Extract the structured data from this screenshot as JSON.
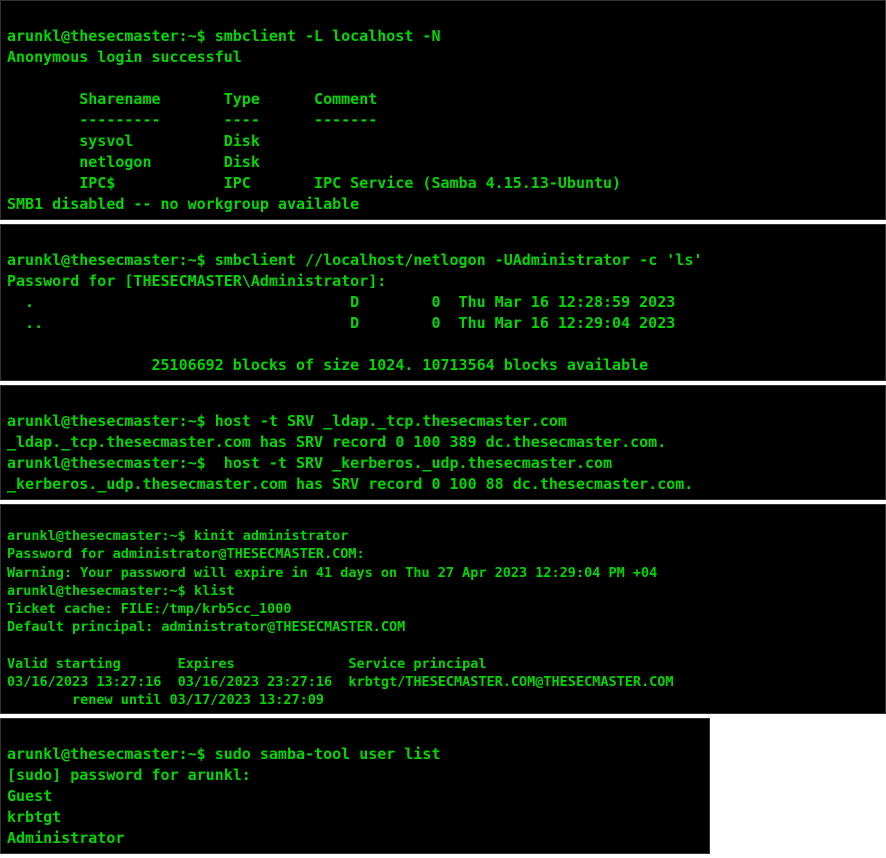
{
  "panels": {
    "p1": {
      "prompt": "arunkl@thesecmaster:~$ ",
      "cmd": "smbclient -L localhost -N",
      "login_msg": "Anonymous login successful",
      "header": "        Sharename       Type      Comment",
      "divider": "        ---------       ----      -------",
      "rows": [
        "        sysvol          Disk      ",
        "        netlogon        Disk      ",
        "        IPC$            IPC       IPC Service (Samba 4.15.13-Ubuntu)"
      ],
      "footer": "SMB1 disabled -- no workgroup available"
    },
    "p2": {
      "prompt": "arunkl@thesecmaster:~$ ",
      "cmd": "smbclient //localhost/netlogon -UAdministrator -c 'ls'",
      "pwd_prompt": "Password for [THESECMASTER\\Administrator]:",
      "rows": [
        "  .                                   D        0  Thu Mar 16 12:28:59 2023",
        "  ..                                  D        0  Thu Mar 16 12:29:04 2023"
      ],
      "footer": "                25106692 blocks of size 1024. 10713564 blocks available"
    },
    "p3": {
      "prompt1": "arunkl@thesecmaster:~$ ",
      "cmd1": "host -t SRV _ldap._tcp.thesecmaster.com",
      "out1": "_ldap._tcp.thesecmaster.com has SRV record 0 100 389 dc.thesecmaster.com.",
      "prompt2": "arunkl@thesecmaster:~$  ",
      "cmd2": "host -t SRV _kerberos._udp.thesecmaster.com",
      "out2": "_kerberos._udp.thesecmaster.com has SRV record 0 100 88 dc.thesecmaster.com."
    },
    "p4": {
      "prompt1": "arunkl@thesecmaster:~$ ",
      "cmd1": "kinit administrator",
      "pwd": "Password for administrator@THESECMASTER.COM:",
      "warn": "Warning: Your password will expire in 41 days on Thu 27 Apr 2023 12:29:04 PM +04",
      "prompt2": "arunkl@thesecmaster:~$ ",
      "cmd2": "klist",
      "ticket": "Ticket cache: FILE:/tmp/krb5cc_1000",
      "principal": "Default principal: administrator@THESECMASTER.COM",
      "tbl_hdr": "Valid starting       Expires              Service principal",
      "tbl_row": "03/16/2023 13:27:16  03/16/2023 23:27:16  krbtgt/THESECMASTER.COM@THESECMASTER.COM",
      "tbl_renew": "        renew until 03/17/2023 13:27:09"
    },
    "p5": {
      "prompt": "arunkl@thesecmaster:~$ ",
      "cmd": "sudo samba-tool user list",
      "sudo": "[sudo] password for arunkl:",
      "users": [
        "Guest",
        "krbtgt",
        "Administrator"
      ]
    }
  }
}
